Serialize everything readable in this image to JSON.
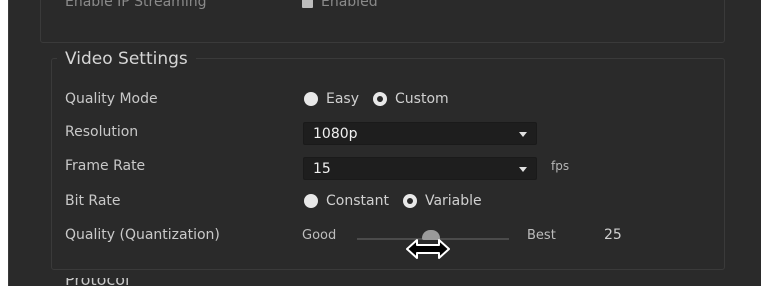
{
  "top_section": {
    "label": "Enable IP Streaming",
    "checkbox_label": "Enabled",
    "checked": true
  },
  "video_settings": {
    "title": "Video Settings",
    "quality_mode": {
      "label": "Quality Mode",
      "options": [
        "Easy",
        "Custom"
      ],
      "selected": "Custom"
    },
    "resolution": {
      "label": "Resolution",
      "value": "1080p"
    },
    "frame_rate": {
      "label": "Frame Rate",
      "value": "15",
      "unit": "fps"
    },
    "bit_rate": {
      "label": "Bit Rate",
      "options": [
        "Constant",
        "Variable"
      ],
      "selected": "Variable"
    },
    "quality": {
      "label": "Quality (Quantization)",
      "min_label": "Good",
      "max_label": "Best",
      "value": "25",
      "slider_fraction": 0.49
    }
  },
  "next_section": {
    "title": "Protocol"
  },
  "colors": {
    "panel": "#2a2a2a",
    "field": "#1e1e1e",
    "text": "#c9c9c9"
  },
  "icons": {
    "cursor": "horizontal-resize-cursor-icon"
  }
}
